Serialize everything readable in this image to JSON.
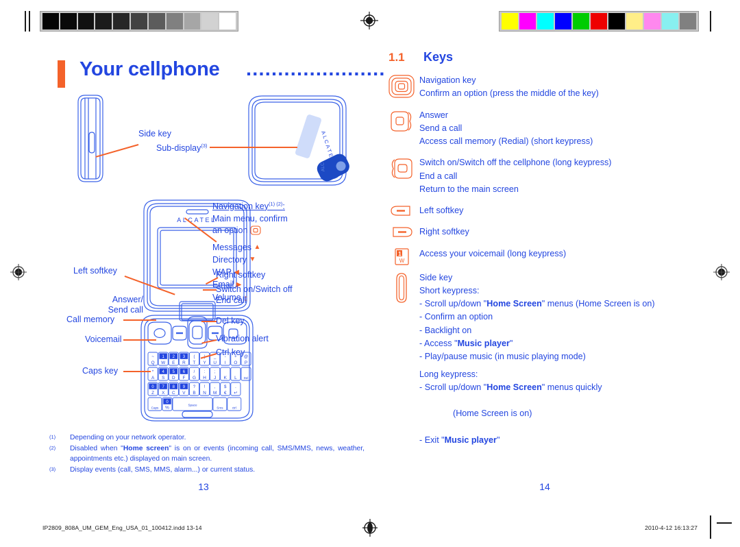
{
  "document": {
    "chapter_title": "Your cellphone",
    "chapter_dots": "......................",
    "page_left": "13",
    "page_right": "14"
  },
  "calibration": {
    "gray_bar_name": "grayscale-calibration-bar",
    "gray_swatches": [
      "#050505",
      "#0a0a0a",
      "#111111",
      "#1b1b1b",
      "#262626",
      "#424242",
      "#5c5c5c",
      "#808080",
      "#a6a6a6",
      "#d2d2d2",
      "#ffffff"
    ],
    "color_bar_name": "color-calibration-bar",
    "color_swatches": [
      "#ffff00",
      "#ff00ff",
      "#00ffff",
      "#0000ff",
      "#00cc00",
      "#ee0000",
      "#000000",
      "#ffee88",
      "#ff88ee",
      "#88f0f0",
      "#808080"
    ]
  },
  "colors": {
    "brand_blue": "#2346e0",
    "accent_orange": "#f4622a"
  },
  "diagram": {
    "brand_text": "ALCATEL",
    "sub_brand_text": "ALCATEL",
    "labels": {
      "side_key": "Side key",
      "sub_display": "Sub-display",
      "sub_display_note": "(3)",
      "left_softkey": "Left softkey",
      "answer_send_1": "Answer/",
      "answer_send_2": "Send call",
      "call_memory": "Call memory",
      "voicemail": "Voicemail",
      "caps_key": "Caps key",
      "right_softkey": "Right softkey",
      "switch_onoff": "Switch on/Switch off",
      "end_call": "End call",
      "del_key": "Del key",
      "vibration_alert": "Vibration alert",
      "ctrl_key": "Ctrl key"
    },
    "navigation_block": {
      "heading": "Navigation key",
      "heading_notes": "(1) (2)",
      "heading_colon": ":",
      "line_main_menu": "Main menu, confirm",
      "line_an_option": "an option",
      "items": [
        {
          "label": "Messages",
          "arrow": "up-arrow-icon",
          "glyph": "▲"
        },
        {
          "label": "Directory",
          "arrow": "down-arrow-icon",
          "glyph": "▼"
        },
        {
          "label": "WAP",
          "arrow": "left-arrow-icon",
          "glyph": "◀"
        },
        {
          "label": "Email",
          "arrow": "right-arrow-icon",
          "glyph": "▶"
        },
        {
          "label": "Volume",
          "arrow": "up-down-arrow-icon",
          "glyph": "↕"
        }
      ]
    },
    "keypad": {
      "rows": [
        [
          {
            "top": "~",
            "main": "Q"
          },
          {
            "top": "1",
            "main": "W"
          },
          {
            "top": "2",
            "main": "E"
          },
          {
            "top": "3",
            "main": "R"
          },
          {
            "top": "(",
            "main": "T"
          },
          {
            "top": ")",
            "main": "Y"
          },
          {
            "top": "_",
            "main": "U"
          },
          {
            "top": "-",
            "main": "I"
          },
          {
            "top": "+",
            "main": "O"
          },
          {
            "top": "@",
            "main": "P"
          }
        ],
        [
          {
            "top": "*",
            "main": "A"
          },
          {
            "top": "4",
            "main": "S"
          },
          {
            "top": "5",
            "main": "D"
          },
          {
            "top": "6",
            "main": "F"
          },
          {
            "top": "/",
            "main": "G"
          },
          {
            "top": ":",
            "main": "H"
          },
          {
            "top": ";",
            "main": "J"
          },
          {
            "top": "",
            "main": "K"
          },
          {
            "top": "",
            "main": "L"
          },
          {
            "top": "",
            "main": "Del"
          }
        ],
        [
          {
            "top": "0",
            "main": "Z"
          },
          {
            "top": "7",
            "main": "X"
          },
          {
            "top": "8",
            "main": "C"
          },
          {
            "top": "9",
            "main": "V"
          },
          {
            "top": "?",
            "main": "B"
          },
          {
            "top": "!",
            "main": "N"
          },
          {
            "top": ",",
            "main": "M"
          },
          {
            "top": "$",
            "main": "€"
          },
          {
            "top": ".",
            "main": "↵"
          }
        ],
        [
          {
            "top": "",
            "main": "Caps"
          },
          {
            "top": "0",
            "main": "%"
          },
          {
            "top": "",
            "main": "Space"
          },
          {
            "top": "",
            "main": "Sms"
          },
          {
            "top": "",
            "main": "ctrl"
          }
        ]
      ]
    }
  },
  "keys_section": {
    "number": "1.1",
    "title": "Keys",
    "rows": [
      {
        "icon": "navigation-key-icon",
        "lines": [
          {
            "text": "Navigation key"
          },
          {
            "text": "Confirm an option (press the middle of the key)"
          }
        ]
      },
      {
        "icon": "send-call-key-icon",
        "lines": [
          {
            "text": "Answer"
          },
          {
            "text": "Send a call"
          },
          {
            "text": "Access call memory (Redial) (short keypress)"
          }
        ]
      },
      {
        "icon": "end-call-key-icon",
        "lines": [
          {
            "text": "Switch on/Switch off the cellphone (long keypress)"
          },
          {
            "text": "End a call"
          },
          {
            "text": "Return to the main screen"
          }
        ]
      },
      {
        "icon": "left-softkey-icon",
        "lines": [
          {
            "text": "Left softkey"
          }
        ]
      },
      {
        "icon": "right-softkey-icon",
        "lines": [
          {
            "text": "Right softkey"
          }
        ]
      },
      {
        "icon": "voicemail-key-icon",
        "icon_label_top": "1",
        "icon_label_bottom": "W",
        "lines": [
          {
            "text": "Access your voicemail (long keypress)"
          }
        ]
      }
    ],
    "side_key_block": {
      "icon": "side-key-icon",
      "title": "Side key",
      "short_heading": "Short keypress:",
      "short_items": [
        {
          "pre": "- Scroll up/down \"",
          "bold": "Home Screen",
          "post": "\" menus (Home Screen is on)"
        },
        {
          "pre": "- Confirm an option",
          "bold": "",
          "post": ""
        },
        {
          "pre": "- Backlight on",
          "bold": "",
          "post": ""
        },
        {
          "pre": "- Access \"",
          "bold": "Music player",
          "post": "\""
        },
        {
          "pre": "- Play/pause music (in music playing mode)",
          "bold": "",
          "post": ""
        }
      ],
      "long_heading": "Long keypress:",
      "long_items": [
        {
          "pre": "- Scroll up/down \"",
          "bold": "Home Screen",
          "post": "\" menus quickly"
        },
        {
          "pre": "  (Home Screen is on)",
          "bold": "",
          "post": ""
        },
        {
          "pre": "- Exit \"",
          "bold": "Music player",
          "post": "\""
        }
      ]
    }
  },
  "footnotes": [
    {
      "marker": "(1)",
      "pre": "Depending on your network operator.",
      "bold": "",
      "post": ""
    },
    {
      "marker": "(2)",
      "pre": "Disabled when \"",
      "bold": "Home screen",
      "post": "\" is on or events (incoming call, SMS/MMS, news, weather, appointments etc.) displayed on main screen."
    },
    {
      "marker": "(3)",
      "pre": "Display events (call, SMS, MMS, alarm...) or current status.",
      "bold": "",
      "post": ""
    }
  ],
  "print_slug": {
    "filename": "IP2809_808A_UM_GEM_Eng_USA_01_100412.indd   13-14",
    "timestamp": "2010-4-12   16:13:27"
  }
}
